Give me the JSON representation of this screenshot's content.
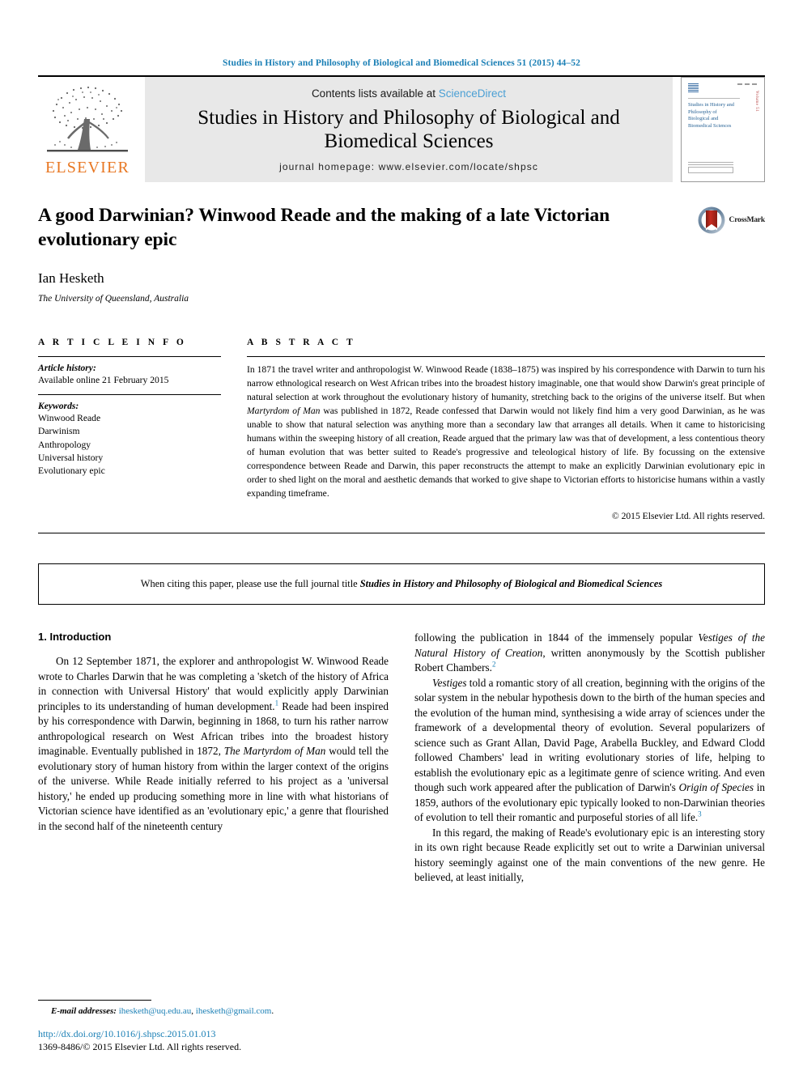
{
  "running_head": "Studies in History and Philosophy of Biological and Biomedical Sciences 51 (2015) 44–52",
  "masthead": {
    "publisher_logo_label": "ELSEVIER",
    "contents_prefix": "Contents lists available at ",
    "contents_link": "ScienceDirect",
    "journal_title": "Studies in History and Philosophy of Biological and Biomedical Sciences",
    "homepage": "journal homepage: www.elsevier.com/locate/shpsc",
    "cover": {
      "title": "Studies in History and Philosophy of Biological and Biomedical Sciences",
      "side_text": "Volume 51"
    }
  },
  "article": {
    "title": "A good Darwinian? Winwood Reade and the making of a late Victorian evolutionary epic",
    "author": "Ian Hesketh",
    "affiliation": "The University of Queensland, Australia",
    "crossmark_label": "CrossMark"
  },
  "info": {
    "heading": "A R T I C L E  I N F O",
    "history_label": "Article history:",
    "history_value": "Available online 21 February 2015",
    "keywords_label": "Keywords:",
    "keywords": [
      "Winwood Reade",
      "Darwinism",
      "Anthropology",
      "Universal history",
      "Evolutionary epic"
    ]
  },
  "abstract": {
    "heading": "A B S T R A C T",
    "part1": "In 1871 the travel writer and anthropologist W. Winwood Reade (1838–1875) was inspired by his correspondence with Darwin to turn his narrow ethnological research on West African tribes into the broadest history imaginable, one that would show Darwin's great principle of natural selection at work throughout the evolutionary history of humanity, stretching back to the origins of the universe itself. But when ",
    "italic1": "Martyrdom of Man",
    "part2": " was published in 1872, Reade confessed that Darwin would not likely find him a very good Darwinian, as he was unable to show that natural selection was anything more than a secondary law that arranges all details. When it came to historicising humans within the sweeping history of all creation, Reade argued that the primary law was that of development, a less contentious theory of human evolution that was better suited to Reade's progressive and teleological history of life. By focussing on the extensive correspondence between Reade and Darwin, this paper reconstructs the attempt to make an explicitly Darwinian evolutionary epic in order to shed light on the moral and aesthetic demands that worked to give shape to Victorian efforts to historicise humans within a vastly expanding timeframe.",
    "copyright": "© 2015 Elsevier Ltd. All rights reserved."
  },
  "citation_notice": {
    "prefix": "When citing this paper, please use the full journal title ",
    "journal": "Studies in History and Philosophy of Biological and Biomedical Sciences"
  },
  "body": {
    "section_number_title": "1. Introduction",
    "left_p1_a": "On 12 September 1871, the explorer and anthropologist W. Winwood Reade wrote to Charles Darwin that he was completing a 'sketch of the history of Africa in connection with Universal History' that would explicitly apply Darwinian principles to its understanding of human development.",
    "left_p1_fn": "1",
    "left_p1_b": " Reade had been inspired by his correspondence with Darwin, beginning in 1868, to turn his rather narrow anthropological research on West African tribes into the broadest history imaginable. Eventually published in 1872, ",
    "left_p1_italic": "The Martyrdom of Man",
    "left_p1_c": " would tell the evolutionary story of human history from within the larger context of the origins of the universe. While Reade initially referred to his project as a 'universal history,' he ended up producing something more in line with what historians of Victorian science have identified as an 'evolutionary epic,' a genre that flourished in the second half of the nineteenth century",
    "right_p1_a": "following the publication in 1844 of the immensely popular ",
    "right_p1_italic": "Vestiges of the Natural History of Creation",
    "right_p1_b": ", written anonymously by the Scottish publisher Robert Chambers.",
    "right_p1_fn": "2",
    "right_p2_italic": "Vestiges",
    "right_p2_a": " told a romantic story of all creation, beginning with the origins of the solar system in the nebular hypothesis down to the birth of the human species and the evolution of the human mind, synthesising a wide array of sciences under the framework of a developmental theory of evolution. Several popularizers of science such as Grant Allan, David Page, Arabella Buckley, and Edward Clodd followed Chambers' lead in writing evolutionary stories of life, helping to establish the evolutionary epic as a legitimate genre of science writing. And even though such work appeared after the publication of Darwin's ",
    "right_p2_italic2": "Origin of Species",
    "right_p2_b": " in 1859, authors of the evolutionary epic typically looked to non-Darwinian theories of evolution to tell their romantic and purposeful stories of all life.",
    "right_p2_fn": "3",
    "right_p3": "In this regard, the making of Reade's evolutionary epic is an interesting story in its own right because Reade explicitly set out to write a Darwinian universal history seemingly against one of the main conventions of the new genre. He believed, at least initially,"
  },
  "footer": {
    "email_label": "E-mail addresses:",
    "email1": "ihesketh@uq.edu.au",
    "email_sep": ", ",
    "email2": "ihesketh@gmail.com",
    "email_end": ".",
    "doi": "http://dx.doi.org/10.1016/j.shpsc.2015.01.013",
    "issn": "1369-8486/© 2015 Elsevier Ltd. All rights reserved."
  },
  "colors": {
    "link_blue": "#1a7fb5",
    "sciencedirect_blue": "#4a9fd4",
    "elsevier_orange": "#E87722",
    "band_grey": "#e8e8e8"
  }
}
